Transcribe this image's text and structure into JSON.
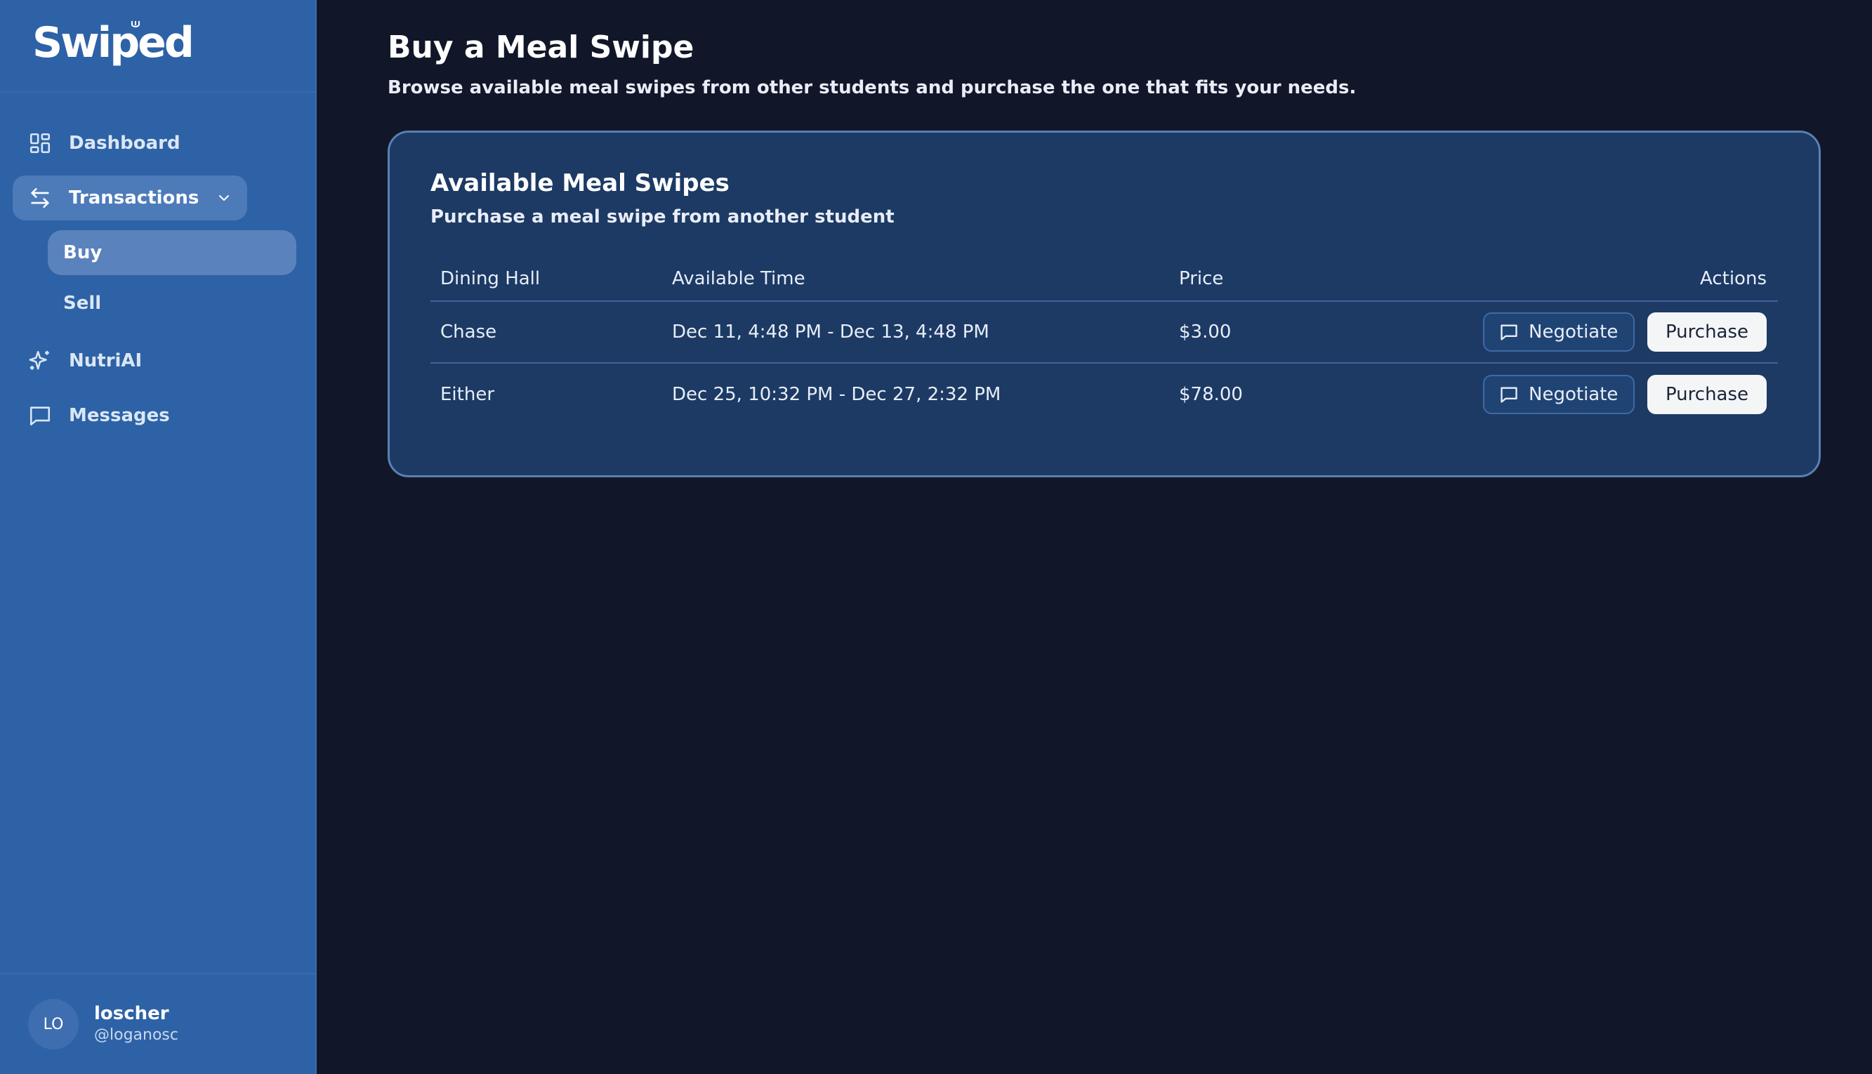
{
  "app": {
    "logo": "Swiped"
  },
  "sidebar": {
    "items": [
      {
        "label": "Dashboard",
        "icon": "dashboard-grid-icon"
      },
      {
        "label": "Transactions",
        "icon": "arrows-left-right-icon"
      },
      {
        "label": "NutriAI",
        "icon": "sparkles-icon"
      },
      {
        "label": "Messages",
        "icon": "message-square-icon"
      }
    ],
    "sub_items": [
      {
        "label": "Buy",
        "active": true
      },
      {
        "label": "Sell",
        "active": false
      }
    ]
  },
  "user": {
    "initials": "LO",
    "name": "loscher",
    "handle": "@loganosc"
  },
  "page": {
    "title": "Buy a Meal Swipe",
    "subtitle": "Browse available meal swipes from other students and purchase the one that fits your needs."
  },
  "card": {
    "title": "Available Meal Swipes",
    "subtitle": "Purchase a meal swipe from another student",
    "columns": [
      "Dining Hall",
      "Available Time",
      "Price",
      "Actions"
    ],
    "rows": [
      {
        "hall": "Chase",
        "time": "Dec 11, 4:48 PM - Dec 13, 4:48 PM",
        "price": "$3.00"
      },
      {
        "hall": "Either",
        "time": "Dec 25, 10:32 PM - Dec 27, 2:32 PM",
        "price": "$78.00"
      }
    ],
    "negotiate_label": "Negotiate",
    "purchase_label": "Purchase"
  },
  "colors": {
    "sidebar_bg": "#2d62a6",
    "main_bg": "#111729",
    "card_bg": "#1c3a64",
    "active_item": "#5a82bd"
  }
}
